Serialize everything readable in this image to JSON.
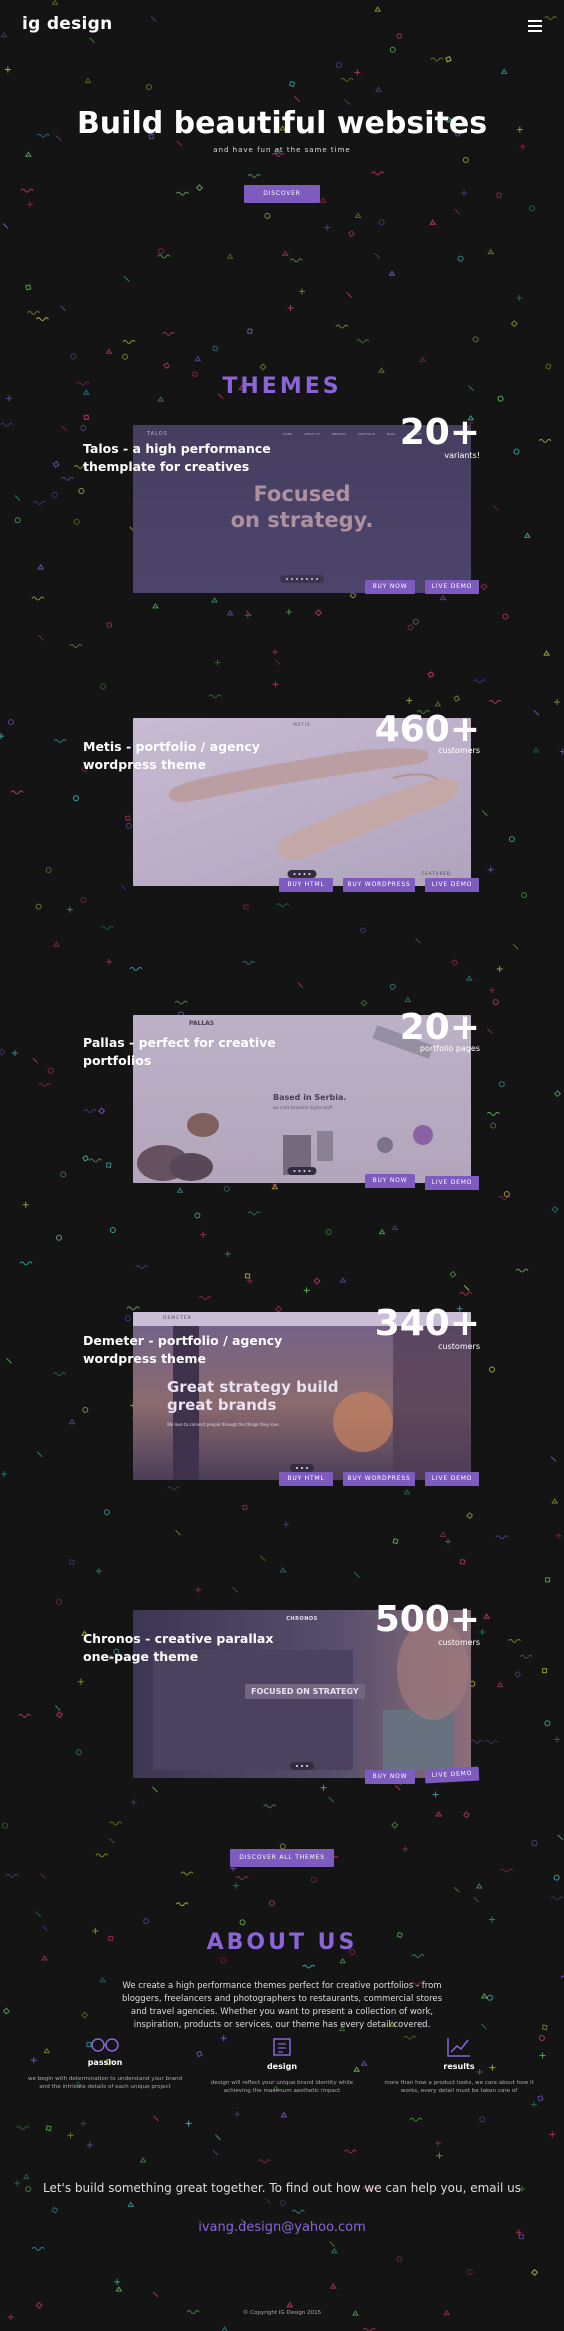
{
  "brand": "ig design",
  "hero": {
    "title": "Build beautiful websites",
    "subtitle": "and have fun at the same time",
    "discover_label": "DISCOVER"
  },
  "themes_title": "THEMES",
  "themes": [
    {
      "title": "Talos - a high performance themplate for creatives",
      "count": "20+",
      "count_label": "variants!",
      "buttons": [
        "BUY NOW",
        "LIVE DEMO"
      ],
      "preview": {
        "logo": "TALOS",
        "headline_line1": "Focused",
        "headline_line2": "on strategy.",
        "nav": [
          "HOME",
          "ABOUT US",
          "SERVICES",
          "PORTFOLIO",
          "BLOG",
          "CONTACT"
        ]
      }
    },
    {
      "title": "Metis - portfolio / agency wordpress theme",
      "count": "460+",
      "count_label": "customers",
      "buttons": [
        "BUY HTML",
        "BUY WORDPRESS",
        "LIVE DEMO"
      ],
      "preview": {
        "logo": "METIS",
        "tag": "FEATURED"
      }
    },
    {
      "title": "Pallas - perfect for creative portfolios",
      "count": "20+",
      "count_label": "portfolio pages",
      "buttons": [
        "BUY NOW",
        "LIVE DEMO"
      ],
      "preview": {
        "logo": "PALLAS",
        "caption": "Based in Serbia.",
        "caption_sub": "we craft beautiful digital stuff"
      }
    },
    {
      "title": "Demeter - portfolio / agency wordpress theme",
      "count": "340+",
      "count_label": "customers",
      "buttons": [
        "BUY HTML",
        "BUY WORDPRESS",
        "LIVE DEMO"
      ],
      "preview": {
        "logo": "DEMETER",
        "headline_line1": "Great strategy build",
        "headline_line2": "great brands",
        "sub": "We love to connect people through the things they love."
      }
    },
    {
      "title": "Chronos - creative parallax one-page theme",
      "count": "500+",
      "count_label": "customers",
      "buttons": [
        "BUY NOW",
        "LIVE DEMO"
      ],
      "preview": {
        "logo": "CHRONOS",
        "headline": "FOCUSED ON STRATEGY"
      }
    }
  ],
  "discover_all_label": "DISCOVER ALL THEMES",
  "about": {
    "title": "ABOUT US",
    "text": "We create a high performance themes perfect for creative portfolios - from bloggers, freelancers and photographers to restaurants, commercial stores and travel agencies. Whether you want to present a collection of work, inspiration, products or services, our theme has every detail covered.",
    "features": [
      {
        "title": "passion",
        "icon": "glasses-icon",
        "text": "we begin with determination to understand your brand and the intricate details of each unique project"
      },
      {
        "title": "design",
        "icon": "frame-icon",
        "text": "design will reflect your unique brand identity while achieving the maximum aesthetic impact"
      },
      {
        "title": "results",
        "icon": "chart-icon",
        "text": "more than how a product looks, we care about how it works, every detail must be taken care of"
      }
    ]
  },
  "contact": {
    "text": "Let's build something great together. To find out how we can help you, email us",
    "email": "ivang.design@yahoo.com"
  },
  "copyright": "© Copyright IG Design 2015",
  "colors": {
    "background": "#141414",
    "accent": "#8a64d8",
    "button": "#7d5bbf"
  }
}
